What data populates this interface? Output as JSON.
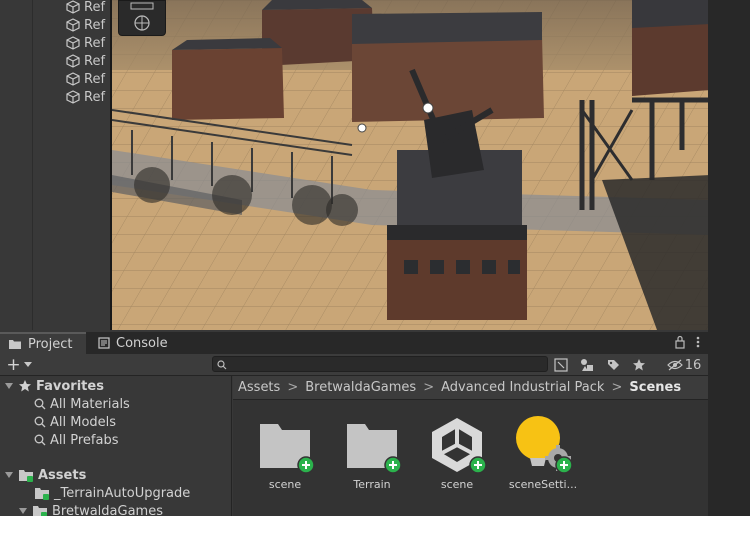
{
  "hierarchy": {
    "items": [
      "Ref",
      "Ref",
      "Ref",
      "Ref",
      "Ref",
      "Ref"
    ]
  },
  "tabs": [
    {
      "label": "Project",
      "icon": "folder-icon",
      "active": true
    },
    {
      "label": "Console",
      "icon": "console-icon",
      "active": false
    }
  ],
  "toolbar": {
    "add_label": "+",
    "search_placeholder": "",
    "hidden_count": "16"
  },
  "tree": {
    "favorites_label": "Favorites",
    "favorites": [
      "All Materials",
      "All Models",
      "All Prefabs"
    ],
    "assets_label": "Assets",
    "assets_children": [
      "_TerrainAutoUpgrade",
      "BretwaldaGames"
    ]
  },
  "breadcrumb": [
    "Assets",
    "BretwaldaGames",
    "Advanced Industrial Pack",
    "Scenes"
  ],
  "files": [
    {
      "name": "scene",
      "type": "folder"
    },
    {
      "name": "Terrain",
      "type": "folder"
    },
    {
      "name": "scene",
      "type": "unity-scene"
    },
    {
      "name": "sceneSetti...",
      "type": "lighting-settings"
    }
  ],
  "colors": {
    "panel": "#383838",
    "accent_add": "#2bb24c",
    "lighting_bulb": "#f7c214"
  }
}
